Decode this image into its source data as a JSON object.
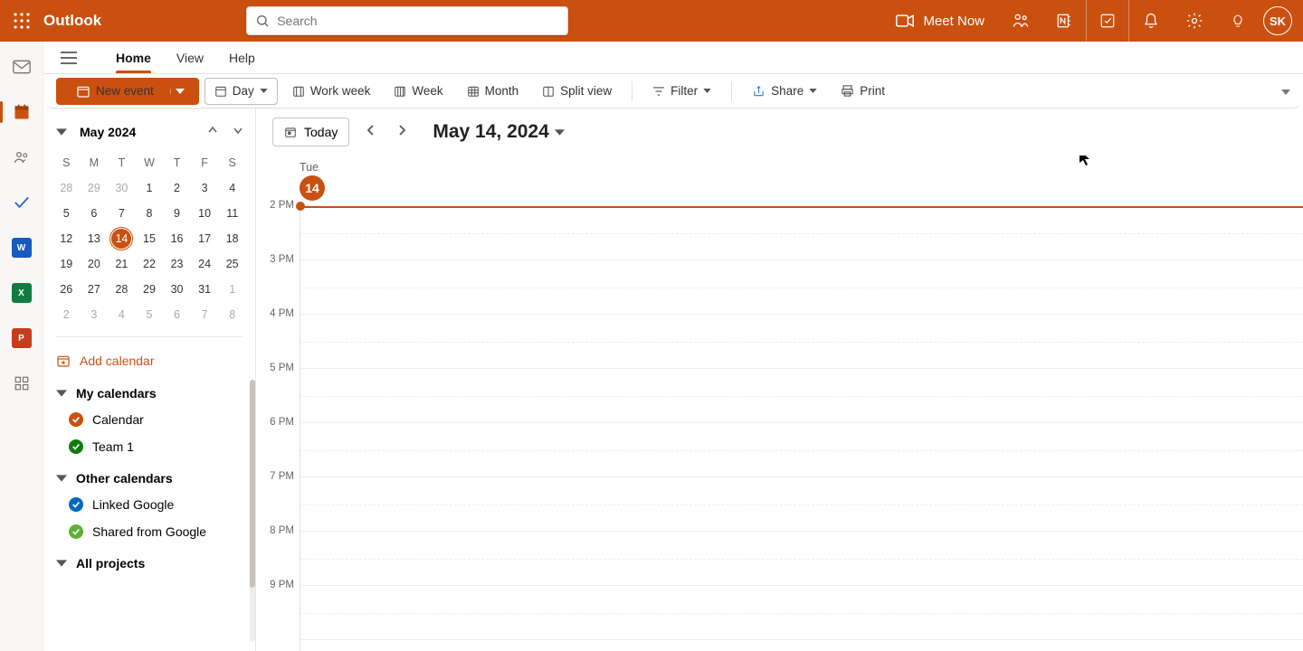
{
  "header": {
    "app_name": "Outlook",
    "search_placeholder": "Search",
    "meet_now_label": "Meet Now",
    "avatar_initials": "SK"
  },
  "menu_tabs": {
    "home": "Home",
    "view": "View",
    "help": "Help"
  },
  "toolbar": {
    "new_event": "New event",
    "day": "Day",
    "work_week": "Work week",
    "week": "Week",
    "month": "Month",
    "split_view": "Split view",
    "filter": "Filter",
    "share": "Share",
    "print": "Print"
  },
  "mini_cal": {
    "title": "May 2024",
    "dow": [
      "S",
      "M",
      "T",
      "W",
      "T",
      "F",
      "S"
    ],
    "rows": [
      [
        {
          "n": 28,
          "dim": true
        },
        {
          "n": 29,
          "dim": true
        },
        {
          "n": 30,
          "dim": true
        },
        {
          "n": 1
        },
        {
          "n": 2
        },
        {
          "n": 3
        },
        {
          "n": 4
        }
      ],
      [
        {
          "n": 5
        },
        {
          "n": 6
        },
        {
          "n": 7
        },
        {
          "n": 8
        },
        {
          "n": 9
        },
        {
          "n": 10
        },
        {
          "n": 11
        }
      ],
      [
        {
          "n": 12
        },
        {
          "n": 13
        },
        {
          "n": 14,
          "today": true
        },
        {
          "n": 15
        },
        {
          "n": 16
        },
        {
          "n": 17
        },
        {
          "n": 18
        }
      ],
      [
        {
          "n": 19
        },
        {
          "n": 20
        },
        {
          "n": 21
        },
        {
          "n": 22
        },
        {
          "n": 23
        },
        {
          "n": 24
        },
        {
          "n": 25
        }
      ],
      [
        {
          "n": 26
        },
        {
          "n": 27
        },
        {
          "n": 28
        },
        {
          "n": 29
        },
        {
          "n": 30
        },
        {
          "n": 31
        },
        {
          "n": 1,
          "dim": true
        }
      ],
      [
        {
          "n": 2,
          "dim": true
        },
        {
          "n": 3,
          "dim": true
        },
        {
          "n": 4,
          "dim": true
        },
        {
          "n": 5,
          "dim": true
        },
        {
          "n": 6,
          "dim": true
        },
        {
          "n": 7,
          "dim": true
        },
        {
          "n": 8,
          "dim": true
        }
      ]
    ]
  },
  "sidebar": {
    "add_calendar": "Add calendar",
    "groups": [
      {
        "title": "My calendars",
        "items": [
          {
            "label": "Calendar",
            "color": "#CA5010"
          },
          {
            "label": "Team 1",
            "color": "#107C10"
          }
        ]
      },
      {
        "title": "Other calendars",
        "items": [
          {
            "label": "Linked Google",
            "color": "#0067C0"
          },
          {
            "label": "Shared from Google",
            "color": "#5DB135"
          }
        ]
      },
      {
        "title": "All projects",
        "items": []
      }
    ]
  },
  "calendar_main": {
    "today_label": "Today",
    "current_date": "May 14, 2024",
    "day_of_week": "Tue",
    "day_number": "14",
    "hours": [
      "2 PM",
      "3 PM",
      "4 PM",
      "5 PM",
      "6 PM",
      "7 PM",
      "8 PM",
      "9 PM"
    ],
    "now_index": 0,
    "now_fraction": 0.0
  },
  "colors": {
    "accent": "#CA5010"
  }
}
